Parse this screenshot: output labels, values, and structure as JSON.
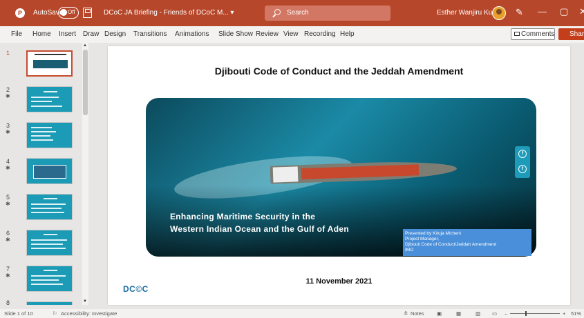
{
  "titlebar": {
    "autosave_label": "AutoSave",
    "autosave_state": "Off",
    "document_title": "DCoC JA Briefing - Friends of DCoC M... ▾",
    "search_placeholder": "Search",
    "user_name": "Esther Wanjiru Kungu",
    "minimize": "—",
    "restore": "▢",
    "close": "✕"
  },
  "menu": {
    "tabs": [
      "File",
      "Home",
      "Insert",
      "Draw",
      "Design",
      "Transitions",
      "Animations",
      "Slide Show",
      "Review",
      "View",
      "Recording",
      "Help"
    ],
    "comments_label": "Comments",
    "share_label": "Share"
  },
  "thumbnails": {
    "numbers": [
      "1",
      "2",
      "3",
      "4",
      "5",
      "6",
      "7",
      "8"
    ],
    "star": "✱"
  },
  "slide": {
    "title": "Djibouti Code of Conduct and the Jeddah Amendment",
    "subtitle_line1": "Enhancing Maritime Security in the",
    "subtitle_line2": "Western Indian Ocean and the Gulf of Aden",
    "presenter_lines": [
      "Presented by Kiruja Micheni",
      "Project Manager,",
      "Djibouti Code of Conduct/Jeddah Amendment",
      "IMO"
    ],
    "date": "11 November 2021",
    "logo": "DC©C"
  },
  "statusbar": {
    "slide_counter": "Slide 1 of 10",
    "accessibility": "Accessibility: Investigate",
    "notes_label": "Notes",
    "zoom_minus": "–",
    "zoom_plus": "+",
    "zoom_level": "51%"
  },
  "colors": {
    "titlebar": "#b7472a",
    "share": "#c43e1c",
    "thumb_teal": "#1b9bb5",
    "presenter_box": "#4a8fd9"
  }
}
